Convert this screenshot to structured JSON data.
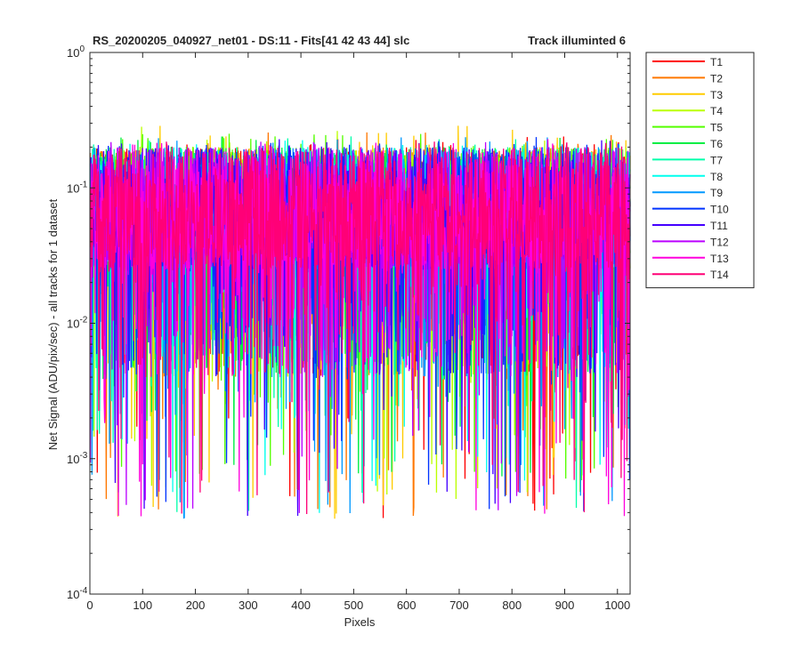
{
  "title_left": "RS_20200205_040927_net01 - DS:11 - Fits[41   42   43   44]    slc",
  "title_right": "Track illuminted 6",
  "chart_data": {
    "type": "line",
    "ylog": true,
    "xlabel": "Pixels",
    "ylabel": "Net Signal (ADU/pix/sec) - all tracks for 1 dataset",
    "xlim": [
      0,
      1024
    ],
    "ylim": [
      0.0001,
      1
    ],
    "xticks": [
      0,
      100,
      200,
      300,
      400,
      500,
      600,
      700,
      800,
      900,
      1000
    ],
    "yticks": [
      {
        "value": 0.0001,
        "base": "10",
        "exp": "-4"
      },
      {
        "value": 0.001,
        "base": "10",
        "exp": "-3"
      },
      {
        "value": 0.01,
        "base": "10",
        "exp": "-2"
      },
      {
        "value": 0.1,
        "base": "10",
        "exp": "-1"
      },
      {
        "value": 1,
        "base": "10",
        "exp": "0"
      }
    ],
    "box": true,
    "grid": false,
    "legend_position": "outside-top-right",
    "series_style": "dense noisy signal per pixel, typical 0.03–0.2, spikes down to ~0.00035 and up to ~0.3",
    "series": [
      {
        "name": "T1",
        "color": "#ff0000",
        "peak": 0.24,
        "min": 0.00036
      },
      {
        "name": "T2",
        "color": "#ff7700",
        "peak": 0.26,
        "min": 0.00036
      },
      {
        "name": "T3",
        "color": "#ffcc00",
        "peak": 0.29,
        "min": 0.00036
      },
      {
        "name": "T4",
        "color": "#bbff00",
        "peak": 0.29,
        "min": 0.0005
      },
      {
        "name": "T5",
        "color": "#55ff00",
        "peak": 0.26,
        "min": 0.0006
      },
      {
        "name": "T6",
        "color": "#00ee44",
        "peak": 0.25,
        "min": 0.0007
      },
      {
        "name": "T7",
        "color": "#00ffaa",
        "peak": 0.24,
        "min": 0.00036
      },
      {
        "name": "T8",
        "color": "#00ffee",
        "peak": 0.23,
        "min": 0.00036
      },
      {
        "name": "T9",
        "color": "#0099ff",
        "peak": 0.24,
        "min": 0.00036
      },
      {
        "name": "T10",
        "color": "#0033ff",
        "peak": 0.24,
        "min": 0.00038
      },
      {
        "name": "T11",
        "color": "#4400ff",
        "peak": 0.23,
        "min": 0.00036
      },
      {
        "name": "T12",
        "color": "#bb00ff",
        "peak": 0.22,
        "min": 0.00036
      },
      {
        "name": "T13",
        "color": "#ff00dd",
        "peak": 0.23,
        "min": 0.00036
      },
      {
        "name": "T14",
        "color": "#ff0077",
        "peak": 0.22,
        "min": 0.00036
      }
    ]
  }
}
